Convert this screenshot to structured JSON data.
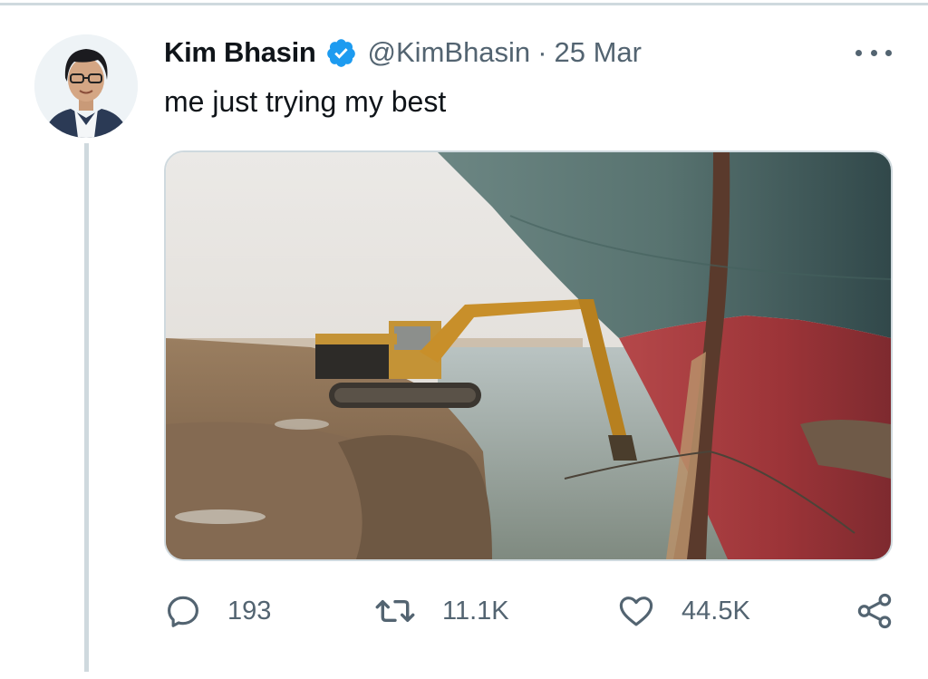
{
  "tweet": {
    "author": {
      "display_name": "Kim Bhasin",
      "handle": "@KimBhasin",
      "verified": true
    },
    "separator": "·",
    "date": "25 Mar",
    "text": "me just trying my best",
    "media": {
      "type": "photo"
    }
  },
  "actions": {
    "reply": {
      "icon": "reply-icon",
      "count": "193"
    },
    "retweet": {
      "icon": "retweet-icon",
      "count": "11.1K"
    },
    "like": {
      "icon": "heart-icon",
      "count": "44.5K"
    },
    "share": {
      "icon": "share-icon"
    }
  },
  "colors": {
    "text_primary": "#0f1419",
    "text_secondary": "#536471",
    "verified_blue": "#1d9bf0",
    "divider": "#cfd9de"
  }
}
